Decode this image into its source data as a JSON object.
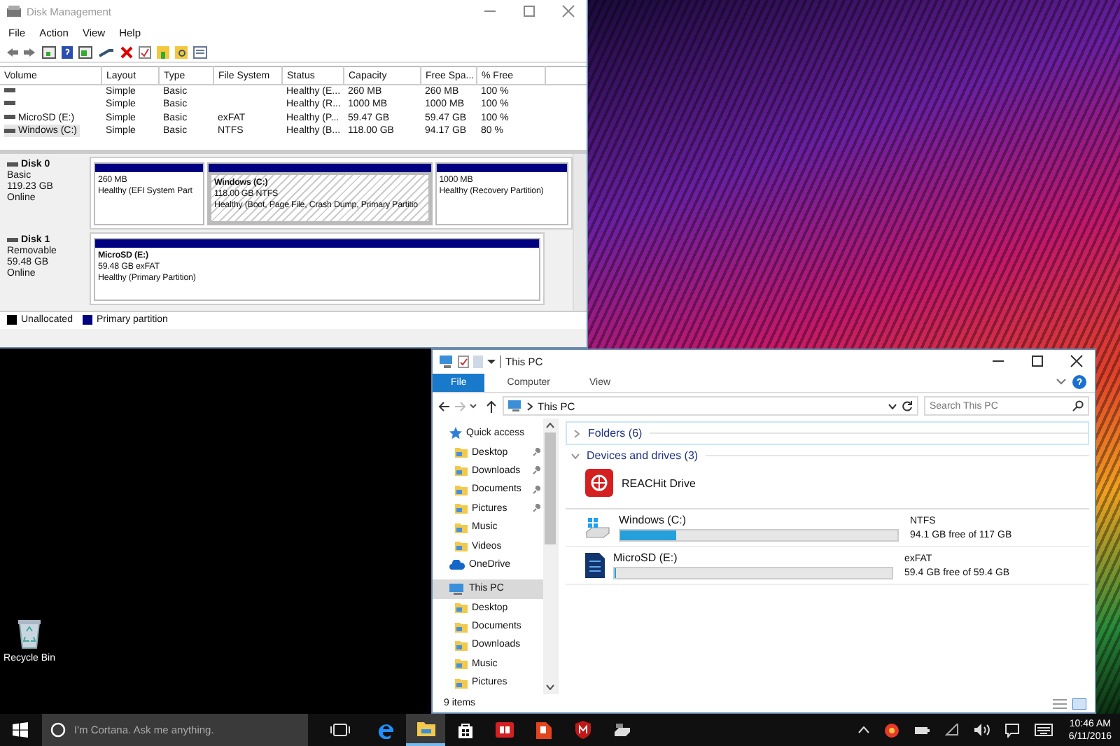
{
  "disk_management": {
    "title": "Disk Management",
    "menu": [
      "File",
      "Action",
      "View",
      "Help"
    ],
    "columns": [
      "Volume",
      "Layout",
      "Type",
      "File System",
      "Status",
      "Capacity",
      "Free Spa...",
      "% Free"
    ],
    "rows": [
      {
        "layout": "Simple",
        "type": "Basic",
        "status": "Healthy (E...",
        "capacity": "260 MB",
        "free_space": "260 MB",
        "percent_free": "100 %",
        "selected": false
      },
      {
        "layout": "Simple",
        "type": "Basic",
        "status": "Healthy (R...",
        "capacity": "1000 MB",
        "free_space": "1000 MB",
        "percent_free": "100 %",
        "selected": false
      },
      {
        "volume": "MicroSD (E:)",
        "layout": "Simple",
        "type": "Basic",
        "file_system": "exFAT",
        "status": "Healthy (P...",
        "capacity": "59.47 GB",
        "free_space": "59.47 GB",
        "percent_free": "100 %",
        "selected": false
      },
      {
        "volume": "Windows (C:)",
        "layout": "Simple",
        "type": "Basic",
        "file_system": "NTFS",
        "status": "Healthy (B...",
        "capacity": "118.00 GB",
        "free_space": "94.17 GB",
        "percent_free": "80 %",
        "selected": true
      }
    ],
    "disks": [
      {
        "name": "Disk 0",
        "details": [
          "Basic",
          "119.23 GB",
          "Online"
        ],
        "partitions": [
          {
            "size": "260 MB",
            "status": "Healthy (EFI System Part",
            "selected": false
          },
          {
            "name": "Windows  (C:)",
            "size": "118.00 GB NTFS",
            "status": "Healthy (Boot, Page File, Crash Dump, Primary Partitio",
            "selected": true
          },
          {
            "size": "1000 MB",
            "status": "Healthy (Recovery Partition)",
            "selected": false
          }
        ]
      },
      {
        "name": "Disk 1",
        "details": [
          "Removable",
          "59.48 GB",
          "Online"
        ],
        "partitions": [
          {
            "name": "MicroSD  (E:)",
            "size": "59.48 GB exFAT",
            "status": "Healthy (Primary Partition)",
            "selected": false
          }
        ]
      }
    ],
    "legend": [
      {
        "label": "Unallocated",
        "color": "#000000"
      },
      {
        "label": "Primary partition",
        "color": "#000080"
      }
    ]
  },
  "explorer": {
    "title": "This PC",
    "ribbon_tabs": [
      {
        "label": "File",
        "selected": true
      },
      {
        "label": "Computer",
        "selected": false
      },
      {
        "label": "View",
        "selected": false
      }
    ],
    "address": "This PC",
    "search": {
      "placeholder": "Search This PC"
    },
    "navigation": [
      {
        "label": "Quick access",
        "kind": "star",
        "selected": false,
        "children": [
          {
            "label": "Desktop",
            "pinned": true,
            "selected": false
          },
          {
            "label": "Downloads",
            "pinned": true,
            "selected": false
          },
          {
            "label": "Documents",
            "pinned": true,
            "selected": false
          },
          {
            "label": "Pictures",
            "pinned": true,
            "selected": false
          },
          {
            "label": "Music",
            "pinned": false,
            "selected": false
          },
          {
            "label": "Videos",
            "pinned": false,
            "selected": false
          }
        ]
      },
      {
        "label": "OneDrive",
        "kind": "cloud",
        "selected": false
      },
      {
        "label": "This PC",
        "kind": "computer",
        "selected": true,
        "children": [
          {
            "label": "Desktop",
            "pinned": false,
            "selected": false
          },
          {
            "label": "Documents",
            "pinned": false,
            "selected": false
          },
          {
            "label": "Downloads",
            "pinned": false,
            "selected": false
          },
          {
            "label": "Music",
            "pinned": false,
            "selected": false
          },
          {
            "label": "Pictures",
            "pinned": false,
            "selected": false
          }
        ]
      }
    ],
    "groups": [
      {
        "label": "Folders (6)",
        "expanded": false
      },
      {
        "label": "Devices and drives (3)",
        "expanded": true
      }
    ],
    "drives": [
      {
        "kind": "app",
        "name": "REACHit Drive"
      },
      {
        "kind": "drive",
        "name": "Windows (C:)",
        "level": 0.2,
        "file_system": "NTFS",
        "free": "94.1 GB free of 117 GB"
      },
      {
        "kind": "sdcard",
        "name": "MicroSD (E:)",
        "level": 0,
        "file_system": "exFAT",
        "free": "59.4 GB free of 59.4 GB"
      }
    ],
    "status": "9 items"
  },
  "desktop": {
    "icons": [
      "Recycle Bin"
    ]
  },
  "taskbar": {
    "search": {
      "placeholder": "I'm Cortana. Ask me anything."
    },
    "apps": [
      {
        "kind": "edge",
        "selected": false
      },
      {
        "kind": "explorer",
        "selected": true
      },
      {
        "kind": "store",
        "selected": false
      },
      {
        "kind": "reader",
        "selected": false
      },
      {
        "kind": "office",
        "selected": false
      },
      {
        "kind": "shield",
        "selected": false
      },
      {
        "kind": "drive",
        "selected": false
      }
    ],
    "time": "10:46 AM",
    "date": "6/11/2016"
  }
}
